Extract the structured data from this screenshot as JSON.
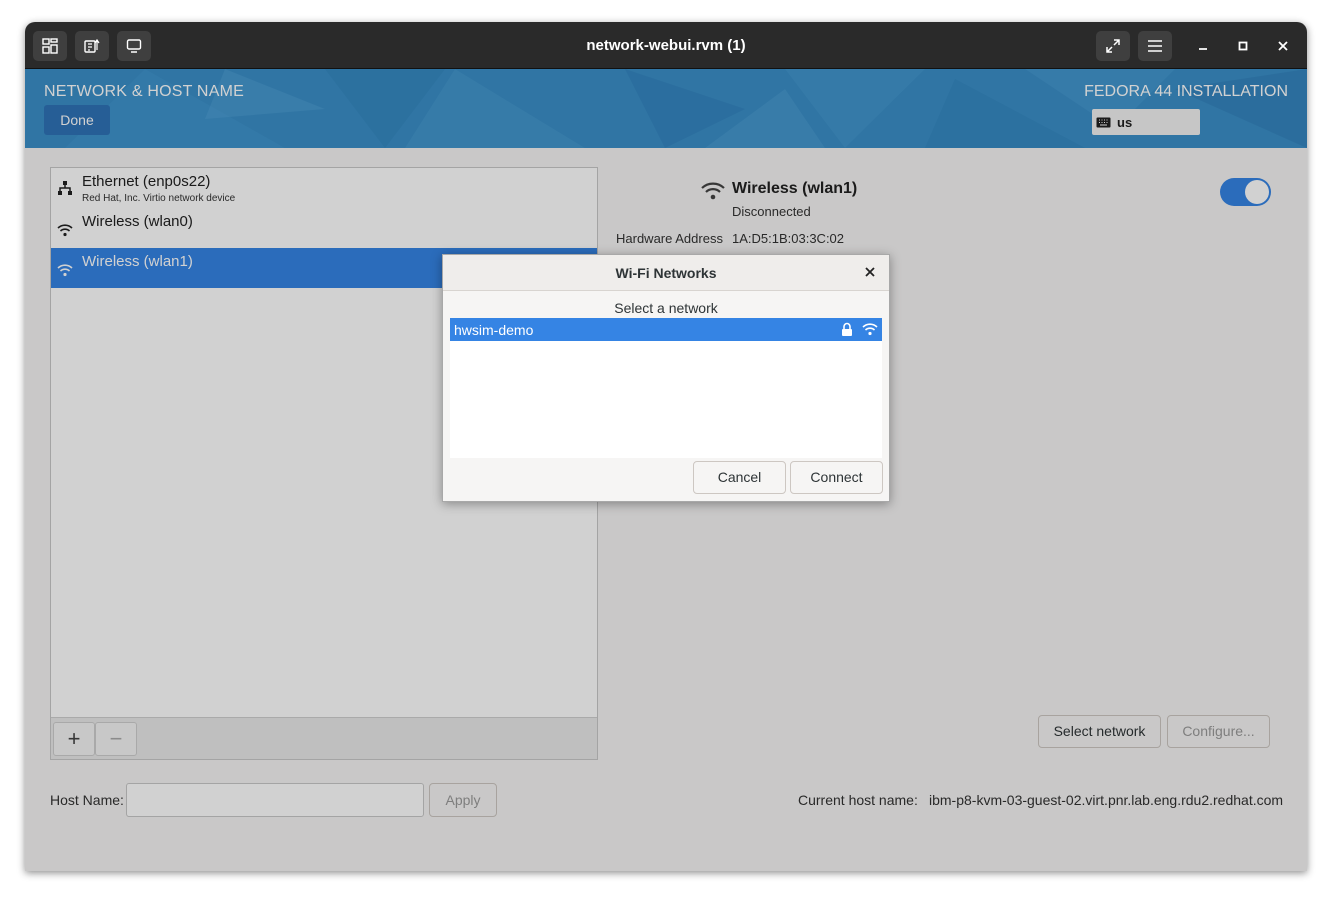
{
  "window": {
    "title": "network-webui.rvm (1)"
  },
  "header": {
    "title": "NETWORK & HOST NAME",
    "done_label": "Done",
    "install_label": "FEDORA 44 INSTALLATION",
    "keyboard_layout": "us"
  },
  "devices": [
    {
      "name": "Ethernet (enp0s22)",
      "subtitle": "Red Hat, Inc. Virtio network device",
      "icon": "ethernet-icon"
    },
    {
      "name": "Wireless (wlan0)",
      "subtitle": "",
      "icon": "wifi-icon"
    },
    {
      "name": "Wireless (wlan1)",
      "subtitle": "",
      "icon": "wifi-icon",
      "selected": true
    }
  ],
  "list_tools": {
    "add": "+",
    "remove": "−"
  },
  "detail": {
    "name": "Wireless (wlan1)",
    "status": "Disconnected",
    "hw_label": "Hardware Address",
    "hw_value": "1A:D5:1B:03:3C:02",
    "enabled": true,
    "select_network_label": "Select network",
    "configure_label": "Configure..."
  },
  "host": {
    "label": "Host Name:",
    "value": "",
    "apply_label": "Apply",
    "current_label": "Current host name:",
    "current_value": "ibm-p8-kvm-03-guest-02.virt.pnr.lab.eng.rdu2.redhat.com"
  },
  "dialog": {
    "title": "Wi-Fi Networks",
    "subtitle": "Select a network",
    "networks": [
      {
        "ssid": "hwsim-demo",
        "secured": true,
        "icon": "wifi-signal-icon"
      }
    ],
    "cancel_label": "Cancel",
    "connect_label": "Connect"
  },
  "colors": {
    "accent": "#3584e4",
    "header": "#3b8fc8",
    "titlebar": "#2a2a2a"
  }
}
